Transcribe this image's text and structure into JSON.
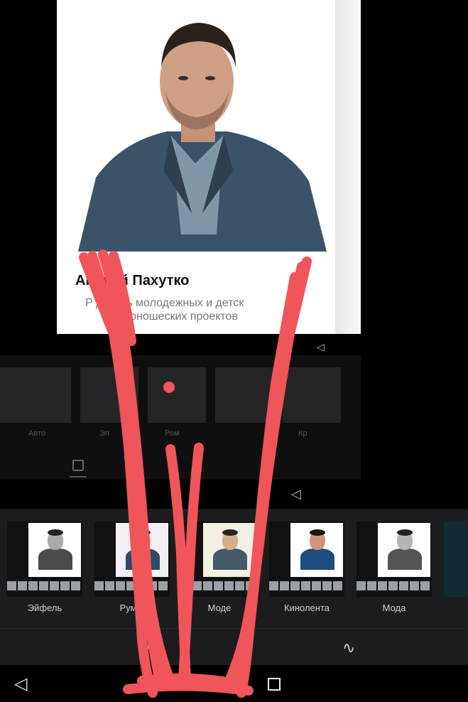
{
  "preview": {
    "name": "Андрей Пахутко",
    "role_line1": "Р      дитель молодежных и детск",
    "role_line2": "юношеских проектов"
  },
  "ghost_panel": {
    "labels": [
      "Авто",
      "Эп",
      "Ром",
      "",
      "Кр"
    ]
  },
  "filters": [
    {
      "label": "Эйфель",
      "tone": "#5a5a5a"
    },
    {
      "label": "Рум    ц",
      "tone": "#2f4558"
    },
    {
      "label": "Моде",
      "tone": "#4a5a4a"
    },
    {
      "label": "Кинолента",
      "tone": "#1f3a5a"
    },
    {
      "label": "Мода",
      "tone": "#4a4a4a"
    }
  ],
  "tools": {
    "center_icon": "adjust-icon",
    "right_icon": "doodle-icon"
  },
  "system_nav": {
    "back_glyph": "◁",
    "home_glyph": "○",
    "recents_glyph": "□"
  },
  "colors": {
    "scribble": "#f0555a",
    "filter_bar_bg": "#1c1c1e",
    "label_text": "#cfcfcf"
  }
}
